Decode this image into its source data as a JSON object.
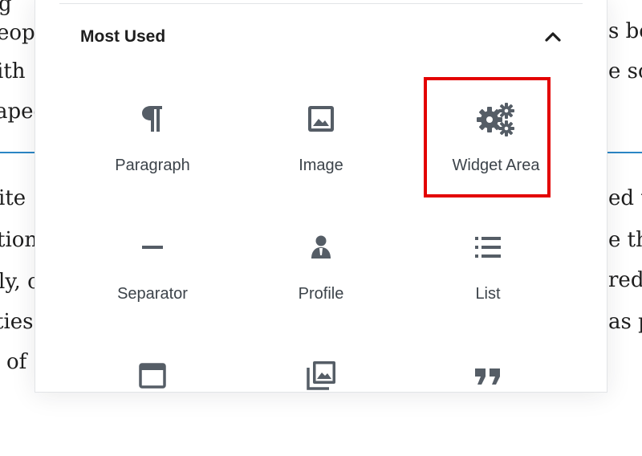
{
  "background_text": {
    "left_fragments": [
      "g",
      "eop",
      "ith",
      "aped",
      "ite",
      "tion",
      "ly, c",
      "ties",
      "of"
    ],
    "right_fragments": [
      "",
      "s be",
      "e sc",
      "",
      "ed to",
      "e the",
      "red",
      "as p",
      ""
    ]
  },
  "panel": {
    "title": "Most Used",
    "blocks": [
      {
        "label": "Paragraph",
        "icon": "paragraph-icon"
      },
      {
        "label": "Image",
        "icon": "image-icon"
      },
      {
        "label": "Widget Area",
        "icon": "gears-icon"
      },
      {
        "label": "Separator",
        "icon": "separator-icon"
      },
      {
        "label": "Profile",
        "icon": "profile-icon"
      },
      {
        "label": "List",
        "icon": "list-icon"
      },
      {
        "label": "",
        "icon": "window-icon"
      },
      {
        "label": "",
        "icon": "gallery-icon"
      },
      {
        "label": "",
        "icon": "quote-icon"
      }
    ]
  },
  "colors": {
    "highlight": "#e30000",
    "accent_rule": "#2b86c5",
    "icon": "#555d66",
    "label": "#3c434a"
  }
}
